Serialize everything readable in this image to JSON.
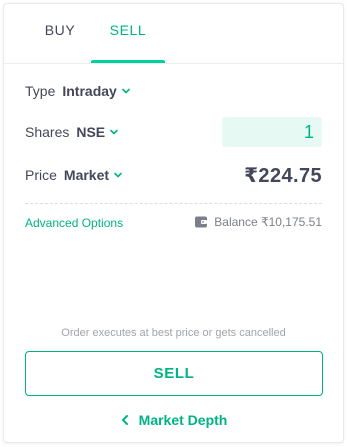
{
  "tabs": [
    {
      "label": "BUY",
      "active": false
    },
    {
      "label": "SELL",
      "active": true
    }
  ],
  "order": {
    "type_label": "Type",
    "type_value": "Intraday",
    "shares_label": "Shares",
    "exchange_value": "NSE",
    "quantity": "1",
    "price_label": "Price",
    "price_type": "Market",
    "price_value": "₹224.75"
  },
  "footer": {
    "advanced_options": "Advanced Options",
    "balance": "Balance ₹10,175.51",
    "note": "Order executes at best price or gets cancelled",
    "sell_button": "SELL",
    "market_depth": "Market Depth"
  },
  "colors": {
    "accent": "#00b386",
    "accent_light": "#e6f9f3",
    "text": "#44475b",
    "muted": "#a1a3ad"
  },
  "icons": [
    "chevron-down-icon",
    "wallet-icon",
    "chevron-left-icon"
  ]
}
